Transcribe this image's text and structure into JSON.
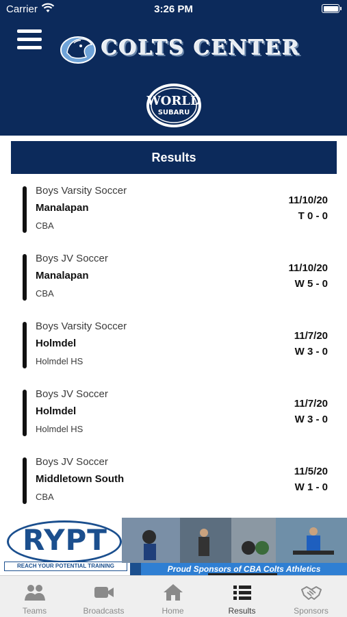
{
  "status_bar": {
    "carrier": "Carrier",
    "time": "3:26 PM"
  },
  "header": {
    "title": "COLTS CENTER",
    "sponsor_logo_text": [
      "WORLD",
      "SUBARU"
    ]
  },
  "section": {
    "title": "Results"
  },
  "results": [
    {
      "team": "Boys Varsity Soccer",
      "opponent": "Manalapan",
      "location": "CBA",
      "date": "11/10/20",
      "score": "T 0 - 0"
    },
    {
      "team": "Boys JV Soccer",
      "opponent": "Manalapan",
      "location": "CBA",
      "date": "11/10/20",
      "score": "W 5 - 0"
    },
    {
      "team": "Boys Varsity Soccer",
      "opponent": "Holmdel",
      "location": "Holmdel HS",
      "date": "11/7/20",
      "score": "W 3 - 0"
    },
    {
      "team": "Boys JV Soccer",
      "opponent": "Holmdel",
      "location": "Holmdel HS",
      "date": "11/7/20",
      "score": "W 3 - 0"
    },
    {
      "team": "Boys JV Soccer",
      "opponent": "Middletown South",
      "location": "CBA",
      "date": "11/5/20",
      "score": "W 1 - 0"
    }
  ],
  "ad": {
    "logo_text": "RYPT",
    "tagline": "REACH YOUR POTENTIAL TRAINING",
    "slogan": "Proud Sponsors of CBA Colts Athletics"
  },
  "tabs": [
    {
      "label": "Teams",
      "icon": "people-icon"
    },
    {
      "label": "Broadcasts",
      "icon": "video-camera-icon"
    },
    {
      "label": "Home",
      "icon": "home-icon"
    },
    {
      "label": "Results",
      "icon": "list-icon"
    },
    {
      "label": "Sponsors",
      "icon": "handshake-icon"
    }
  ],
  "active_tab": "Results",
  "colors": {
    "navy": "#0c2a5b",
    "tab_bar": "#efefef",
    "ad_blue": "#1b4f8e"
  }
}
